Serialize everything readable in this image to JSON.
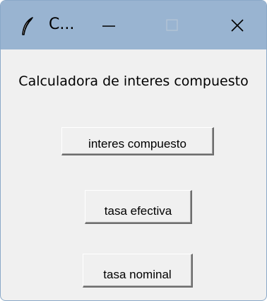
{
  "window": {
    "title": "C...",
    "icons": {
      "app": "feather-icon",
      "minimize": "minimize-icon",
      "maximize": "maximize-icon",
      "close": "close-icon"
    },
    "colors": {
      "titlebar": "#99b4d1",
      "body": "#f0f0f0",
      "maximize_disabled": "#b7c6d6"
    }
  },
  "main": {
    "heading": "Calculadora de interes compuesto",
    "buttons": [
      {
        "label": "interes compuesto"
      },
      {
        "label": "tasa efectiva"
      },
      {
        "label": "tasa nominal"
      }
    ]
  }
}
